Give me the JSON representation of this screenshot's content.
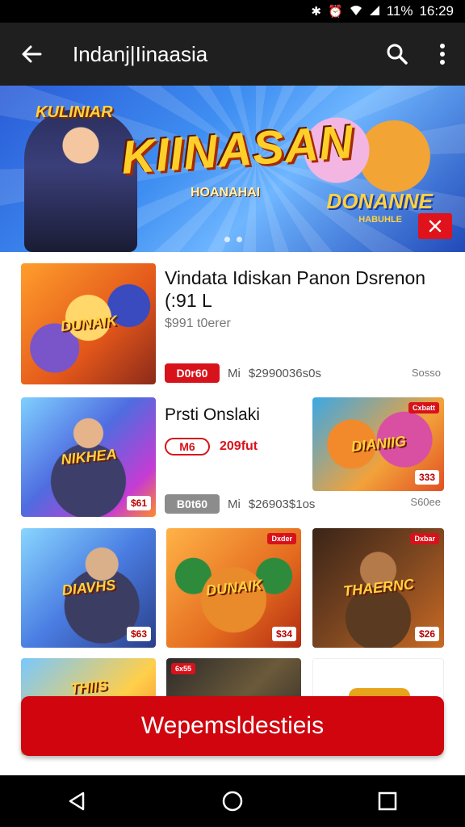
{
  "status_bar": {
    "battery": "11%",
    "time": "16:29",
    "icons": [
      "bluetooth-icon",
      "alarm-icon",
      "wifi-icon",
      "signal-icon"
    ]
  },
  "app_bar": {
    "title": "Indanj|Iinaasia",
    "icons": [
      "back-arrow-icon",
      "search-icon",
      "overflow-menu-icon"
    ]
  },
  "banner": {
    "logo_top": "KULINIAR",
    "logo_small": "HOANAHAI",
    "logo_main": "KIINASAN",
    "logo_right": "DONANNE",
    "logo_right_sub": "HABUHLE",
    "close_icon": "close-icon",
    "accent": "#e0121b"
  },
  "list": {
    "item1": {
      "title": "Vindata Idiskan Panon Dsrenon (:91 L",
      "subtitle": "$991 t0erer",
      "pill": "D0r60",
      "meta_a": "Mi",
      "meta_price": "$2990036s0s",
      "more": "Sosso",
      "thumb_label": "DUNAIK"
    },
    "item2": {
      "title": "Prsti Onslaki",
      "tag": "M6",
      "tag_value": "209fut",
      "pill": "B0t60",
      "meta_a": "Mi",
      "meta_price": "$26903$1os",
      "more": "S60ee",
      "thumb_a_label": "NIKHEA",
      "thumb_a_price": "$61",
      "thumb_b_label": "DIANIIG",
      "thumb_b_price": "333",
      "thumb_b_corner": "Cxbatt"
    },
    "row3": [
      {
        "label": "DIAVHS",
        "price": "$63"
      },
      {
        "label": "DUNAIK",
        "price": "$34",
        "corner": "Dxder"
      },
      {
        "label": "THAERNC",
        "price": "$26",
        "corner": "Dxbar"
      }
    ],
    "row4": [
      {
        "label": "THIIS"
      },
      {
        "label": "",
        "corner": "6x55"
      },
      {
        "label": ""
      }
    ]
  },
  "cta": {
    "label": "Wepemsldestieis",
    "color": "#d0050e"
  },
  "nav_bar": {
    "icons": [
      "nav-back-icon",
      "nav-home-icon",
      "nav-recents-icon"
    ]
  }
}
